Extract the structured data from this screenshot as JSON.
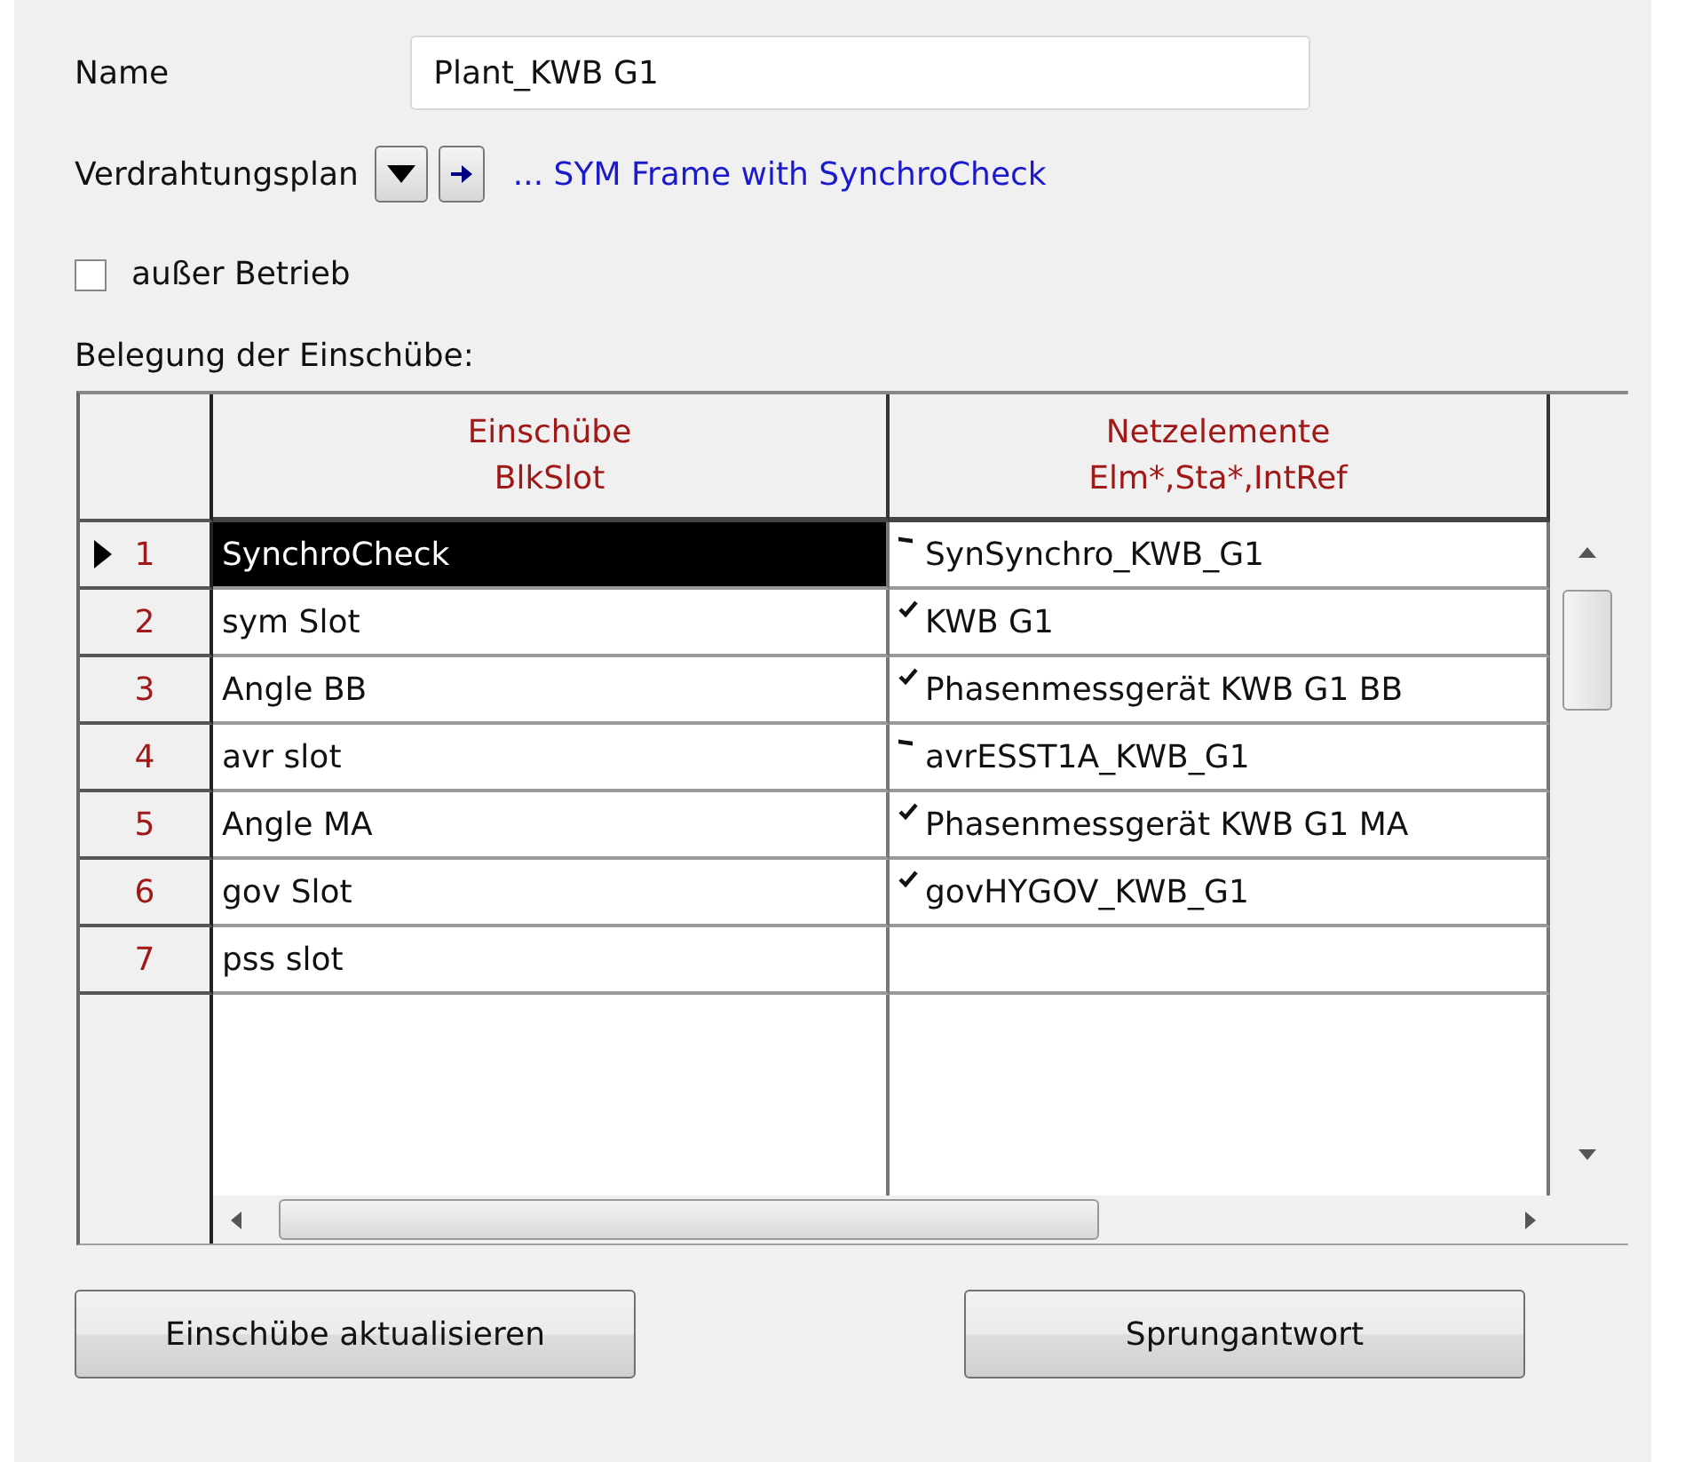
{
  "name_field": {
    "label": "Name",
    "value": "Plant_KWB G1"
  },
  "wiring": {
    "label": "Verdrahtungsplan",
    "link": "... SYM Frame with SynchroCheck"
  },
  "out_of_service": {
    "label": "außer Betrieb",
    "checked": false
  },
  "table": {
    "caption": "Belegung der Einschübe:",
    "columns": [
      {
        "title": "Einschübe",
        "subtitle": "BlkSlot"
      },
      {
        "title": "Netzelemente",
        "subtitle": "Elm*,Sta*,IntRef"
      }
    ],
    "rows": [
      {
        "index": "1",
        "selected": true,
        "slot": "SynchroCheck",
        "element": "SynSynchro_KWB_G1",
        "kind": "dash"
      },
      {
        "index": "2",
        "selected": false,
        "slot": "sym Slot",
        "element": "KWB G1",
        "kind": "check"
      },
      {
        "index": "3",
        "selected": false,
        "slot": "Angle BB",
        "element": "Phasenmessgerät KWB G1 BB",
        "kind": "check"
      },
      {
        "index": "4",
        "selected": false,
        "slot": "avr slot",
        "element": "avrESST1A_KWB_G1",
        "kind": "dash"
      },
      {
        "index": "5",
        "selected": false,
        "slot": "Angle MA",
        "element": "Phasenmessgerät KWB G1 MA",
        "kind": "check"
      },
      {
        "index": "6",
        "selected": false,
        "slot": "gov Slot",
        "element": "govHYGOV_KWB_G1",
        "kind": "check"
      },
      {
        "index": "7",
        "selected": false,
        "slot": "pss slot",
        "kind": "none"
      }
    ]
  },
  "buttons": [
    "Einschübe aktualisieren",
    "Sprungantwort"
  ]
}
